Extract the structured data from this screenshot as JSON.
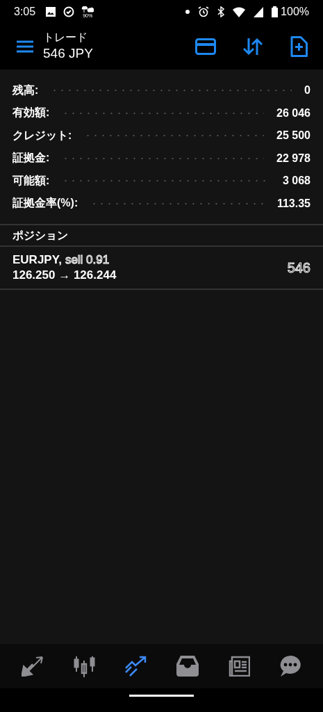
{
  "status_bar": {
    "time": "3:05",
    "weather_percent": "90%",
    "battery": "100%"
  },
  "app_bar": {
    "title": "トレード",
    "subtitle": "546 JPY"
  },
  "account": [
    {
      "label": "残高:",
      "value": "0"
    },
    {
      "label": "有効額:",
      "value": "26 046"
    },
    {
      "label": "クレジット:",
      "value": "25 500"
    },
    {
      "label": "証拠金:",
      "value": "22 978"
    },
    {
      "label": "可能額:",
      "value": "3 068"
    },
    {
      "label": "証拠金率(%):",
      "value": "113.35"
    }
  ],
  "positions_header": "ポジション",
  "positions": [
    {
      "symbol": "EURJPY,",
      "side": "sell 0.91",
      "prices": "126.250 → 126.244",
      "profit": "546"
    }
  ],
  "nav": [
    {
      "kind": "quotes",
      "selected": false
    },
    {
      "kind": "chart",
      "selected": false
    },
    {
      "kind": "trade",
      "selected": true
    },
    {
      "kind": "history",
      "selected": false
    },
    {
      "kind": "news",
      "selected": false
    },
    {
      "kind": "chat",
      "selected": false
    }
  ]
}
